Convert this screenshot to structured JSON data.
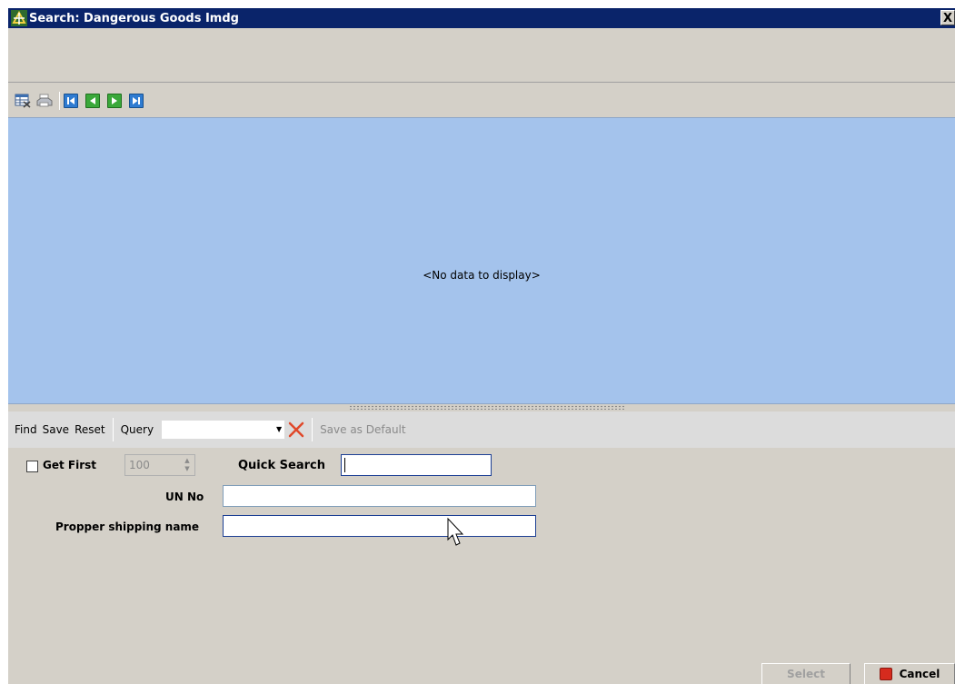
{
  "window": {
    "title": "Search: Dangerous Goods Imdg",
    "close_label": "X"
  },
  "toolbar": {
    "icons": [
      "grid-options-icon",
      "print-icon",
      "first-record-icon",
      "previous-record-icon",
      "next-record-icon",
      "last-record-icon"
    ]
  },
  "grid": {
    "empty_text": "<No data to display>"
  },
  "query_bar": {
    "find_label": "Find",
    "save_label": "Save",
    "reset_label": "Reset",
    "query_label": "Query",
    "query_value": "",
    "save_default_label": "Save as Default"
  },
  "form": {
    "get_first_label": "Get First",
    "get_first_checked": false,
    "get_first_value": "100",
    "quick_search_label": "Quick Search",
    "quick_search_value": "",
    "un_no_label": "UN No",
    "un_no_value": "",
    "shipping_name_label": "Propper shipping name",
    "shipping_name_value": ""
  },
  "buttons": {
    "select_label": "Select",
    "cancel_label": "Cancel"
  },
  "colors": {
    "title_bar": "#0a246a",
    "grid_background": "#a4c3ec",
    "cancel_icon": "#d62b1e"
  }
}
